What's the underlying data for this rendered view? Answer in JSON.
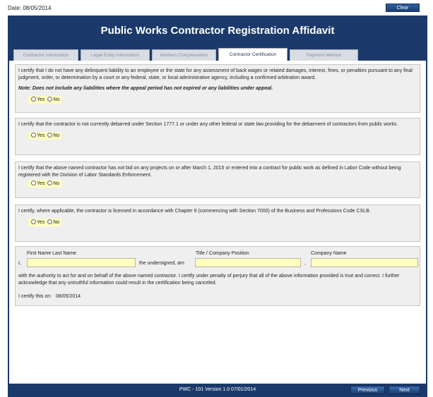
{
  "top": {
    "date_label": "Date:",
    "date_value": "08/05/2014",
    "clear_label": "Clear"
  },
  "header": {
    "title": "Public Works Contractor Registration Affidavit"
  },
  "tabs": [
    {
      "label": "Contractor Information"
    },
    {
      "label": "Legal Entity Information"
    },
    {
      "label": "Workers Compensation"
    },
    {
      "label": "Contractor Certification",
      "active": true
    },
    {
      "label": "Payment Method"
    }
  ],
  "sections": [
    {
      "text": "I certify that I do not have any delinquent liability to an employee or the state for any assessment of back wages or related damages, interest, fines, or penalties pursuant to any final judgment, order, or determination by a court or any federal, state, or local administrative agency, including a confirmed arbitration award.",
      "note": "Note: Does not include any liabilities where the appeal period has not expired or any liabilities under appeal."
    },
    {
      "text": "I certify that the contractor is not currently debarred under Section 1777.1 or under any other federal or state law providing for the debarment of contractors from public works."
    },
    {
      "text": "I certify that the above named contractor has not bid on any projects on or after March 1, 2015 or entered into a contract for public work as defined in Labor Code without being registered with the Division of Labor Standards Enforcement."
    },
    {
      "text": "I certify, where applicable, the contractor is licensed in accordance with Chapter 9 (commencing with Section 7000) of the Business and Professions Code CSLB."
    }
  ],
  "options": {
    "yes": "Yes",
    "no": "No"
  },
  "signature": {
    "name_label": "First Name Last Name",
    "title_label": "Title / Company Position",
    "company_label": "Company Name",
    "prefix": "I,",
    "middle": "the undersigned, am",
    "comma": ",",
    "statement": "with the authority to act for and on behalf of the above named contractor. I certify under penalty of perjury that all of the above information provided is true and correct. I further acknowledge that any untruthful information could result in the certification being canceled.",
    "certify_label": "I certify this on:",
    "certify_date": "08/05/2014",
    "name_value": "",
    "title_value": "",
    "company_value": ""
  },
  "footer": {
    "version": "PWC - 101 Version 1.0 07/01/2014",
    "previous": "Previous",
    "next": "Next"
  }
}
